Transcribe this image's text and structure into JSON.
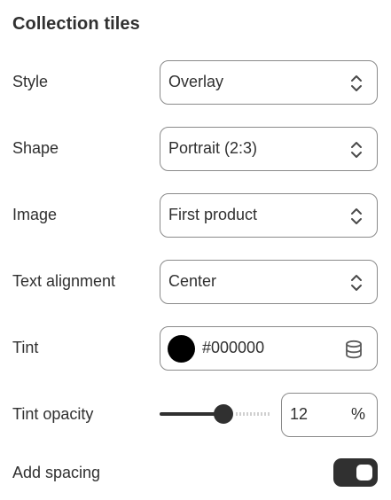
{
  "panel": {
    "title": "Collection tiles"
  },
  "fields": {
    "style": {
      "label": "Style",
      "value": "Overlay"
    },
    "shape": {
      "label": "Shape",
      "value": "Portrait (2:3)"
    },
    "image": {
      "label": "Image",
      "value": "First product"
    },
    "text_alignment": {
      "label": "Text alignment",
      "value": "Center"
    },
    "tint": {
      "label": "Tint",
      "value": "#000000",
      "swatch_color": "#000000",
      "icon": "database-icon"
    },
    "tint_opacity": {
      "label": "Tint opacity",
      "value": "12",
      "unit": "%",
      "slider_fraction": 0.58
    },
    "add_spacing": {
      "label": "Add spacing",
      "enabled": true
    }
  }
}
